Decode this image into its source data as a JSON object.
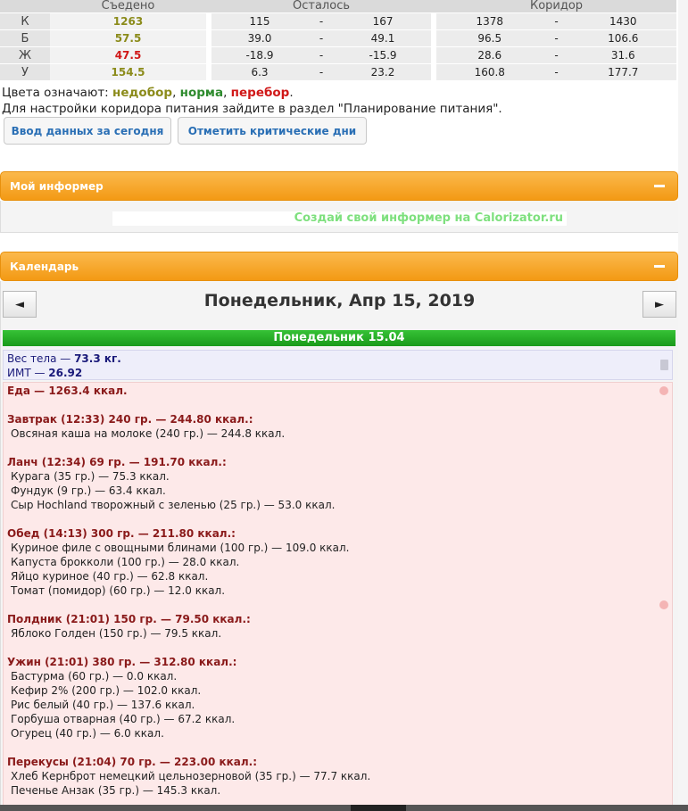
{
  "table": {
    "headers": [
      "Съедено",
      "Осталось",
      "Коридор"
    ],
    "rows": [
      {
        "label": "К",
        "eaten": "1263",
        "eaten_color": "olive",
        "left_min": "115",
        "left_max": "167",
        "cor_min": "1378",
        "cor_max": "1430"
      },
      {
        "label": "Б",
        "eaten": "57.5",
        "eaten_color": "olive",
        "left_min": "39.0",
        "left_max": "49.1",
        "cor_min": "96.5",
        "cor_max": "106.6"
      },
      {
        "label": "Ж",
        "eaten": "47.5",
        "eaten_color": "red",
        "left_min": "-18.9",
        "left_max": "-15.9",
        "cor_min": "28.6",
        "cor_max": "31.6"
      },
      {
        "label": "У",
        "eaten": "154.5",
        "eaten_color": "olive",
        "left_min": "6.3",
        "left_max": "23.2",
        "cor_min": "160.8",
        "cor_max": "177.7"
      }
    ],
    "dash": "-"
  },
  "legend": {
    "prefix": "Цвета означают: ",
    "under": "недобор",
    "norm": "норма",
    "over": "перебор",
    "sep1": ", ",
    "sep2": ", ",
    "end": "."
  },
  "hint": "Для настройки коридора питания зайдите в раздел \"Планирование питания\".",
  "buttons": {
    "today": "Ввод данных за сегодня",
    "critical": "Отметить критические дни"
  },
  "informer": {
    "title": "Мой информер",
    "link": "Создай свой информер на Calorizator.ru"
  },
  "calendar": {
    "title": "Календарь",
    "date": "Понедельник, Апр 15, 2019",
    "prev": "◄",
    "next": "►",
    "day_header": "Понедельник 15.04",
    "weight_label": "Вес тела — ",
    "weight_value": "73.3 кг.",
    "bmi_label": "ИМТ — ",
    "bmi_value": "26.92",
    "food_total": "Еда — 1263.4 ккал."
  },
  "meals": [
    {
      "head": "Завтрак (12:33) 240 гр. — 244.80 ккал.:",
      "items": [
        "Овсяная каша на молоке (240 гр.) — 244.8 ккал."
      ]
    },
    {
      "head": "Ланч (12:34) 69 гр. — 191.70 ккал.:",
      "items": [
        "Курага (35 гр.) — 75.3 ккал.",
        "Фундук (9 гр.) — 63.4 ккал.",
        "Сыр Hochland творожный с зеленью (25 гр.) — 53.0 ккал."
      ]
    },
    {
      "head": "Обед (14:13) 300 гр. — 211.80 ккал.:",
      "items": [
        "Куриное филе с овощными блинами (100 гр.) — 109.0 ккал.",
        "Капуста брокколи (100 гр.) — 28.0 ккал.",
        "Яйцо куриное (40 гр.) — 62.8 ккал.",
        "Томат (помидор) (60 гр.) — 12.0 ккал."
      ]
    },
    {
      "head": "Полдник (21:01) 150 гр. — 79.50 ккал.:",
      "items": [
        "Яблоко Голден (150 гр.) — 79.5 ккал."
      ]
    },
    {
      "head": "Ужин (21:01) 380 гр. — 312.80 ккал.:",
      "items": [
        "Бастурма (60 гр.) — 0.0 ккал.",
        "Кефир 2% (200 гр.) — 102.0 ккал.",
        "Рис белый (40 гр.) — 137.6 ккал.",
        "Горбуша отварная (40 гр.) — 67.2 ккал.",
        "Огурец (40 гр.) — 6.0 ккал."
      ]
    },
    {
      "head": "Перекусы (21:04) 70 гр. — 223.00 ккал.:",
      "items": [
        "Хлеб Кернброт немецкий цельнозерновой (35 гр.) — 77.7 ккал.",
        "Печенье Анзак (35 гр.) — 145.3 ккал."
      ]
    }
  ],
  "colors": {
    "accent_orange": "#f39a14",
    "day_green": "#1a9a1a",
    "link_blue": "#2a6fb5",
    "meal_red": "#8a1a1a"
  }
}
